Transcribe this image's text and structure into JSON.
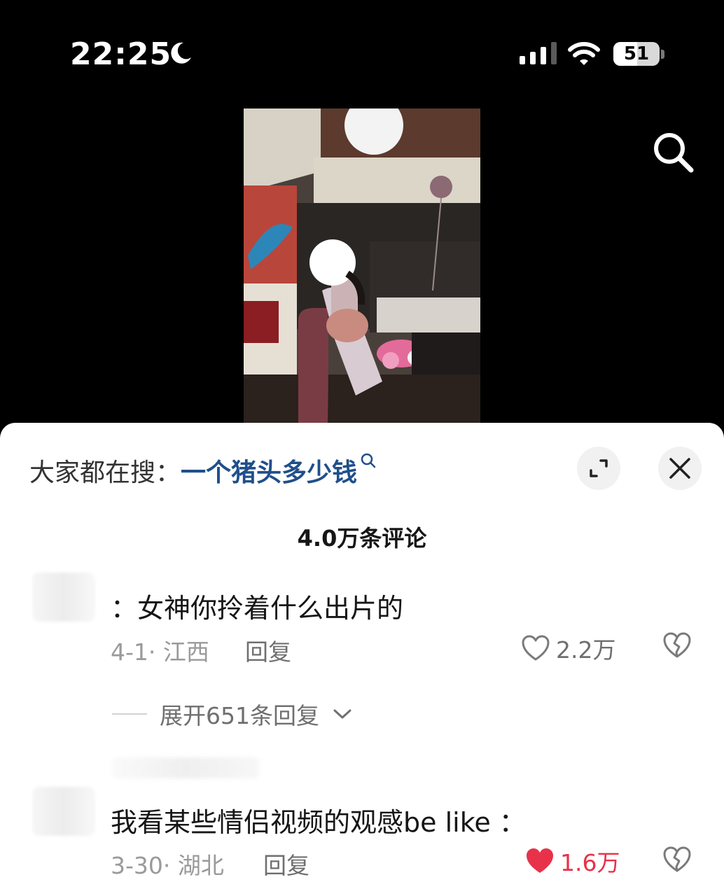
{
  "status_bar": {
    "time": "22:25",
    "battery": "51",
    "battery_level": 0.51,
    "icons": [
      "moon-icon",
      "cellular-signal-icon",
      "wifi-icon",
      "battery-icon"
    ]
  },
  "header": {
    "search_icon": "search-icon"
  },
  "comments_panel": {
    "hot_search_label": "大家都在搜：",
    "hot_search_term": "一个猪头多少钱",
    "count_label": "4.0万条评论",
    "colors": {
      "search_term": "#1f4f8a",
      "liked": "#e8324a",
      "muted": "#9a9a9a"
    },
    "comments": [
      {
        "text": "：女神你拎着什么出片的",
        "date_location": "4-1· 江西",
        "reply_label": "回复",
        "likes": "2.2万",
        "liked": false,
        "expand_replies": "展开651条回复"
      },
      {
        "text": "我看某些情侣视频的观感be like ：",
        "date_location": "3-30· 湖北",
        "reply_label": "回复",
        "likes": "1.6万",
        "liked": true
      }
    ]
  }
}
